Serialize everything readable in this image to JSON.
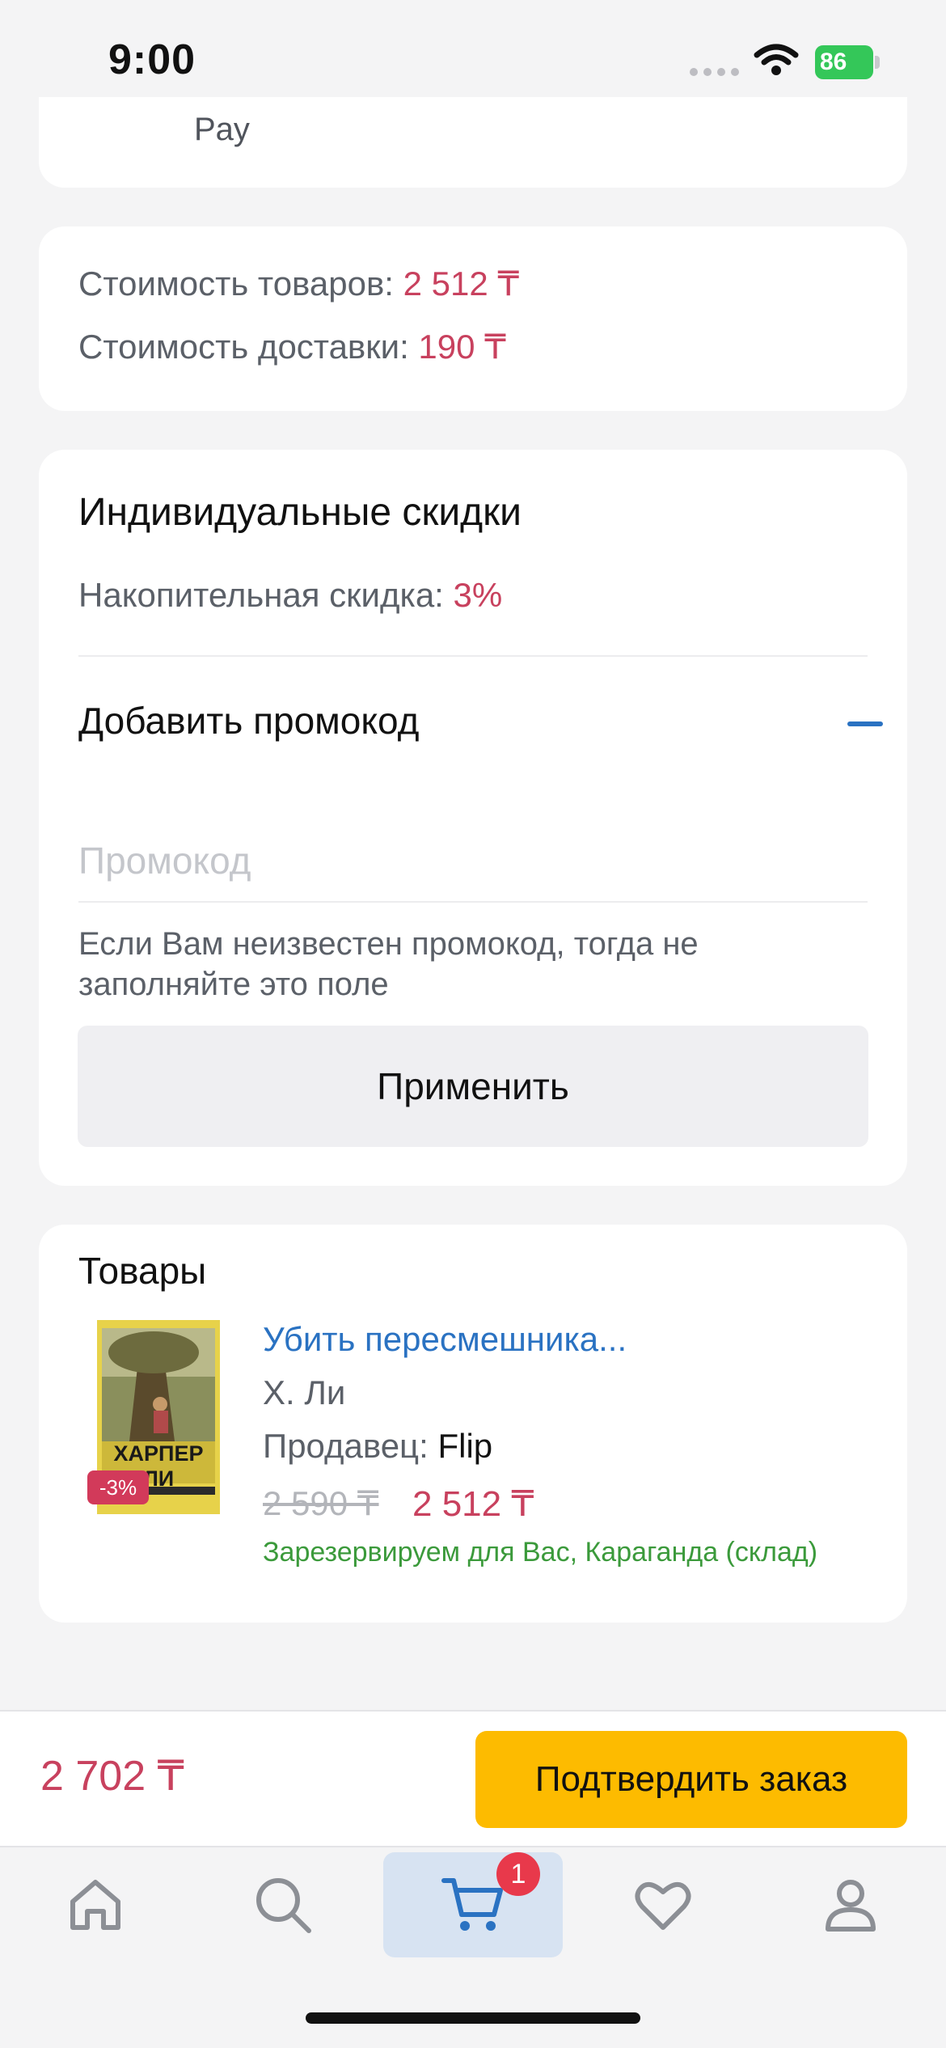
{
  "status_bar": {
    "time": "9:00",
    "battery": "86"
  },
  "payment": {
    "partial_text": "Pay"
  },
  "costs": {
    "goods_label": "Стоимость товаров:",
    "goods_value": "2 512 ₸",
    "delivery_label": "Стоимость доставки:",
    "delivery_value": "190 ₸"
  },
  "discounts": {
    "title": "Индивидуальные скидки",
    "cumulative_label": "Накопительная скидка:",
    "cumulative_value": "3%",
    "promo_header": "Добавить промокод",
    "promo_placeholder": "Промокод",
    "promo_value": "",
    "hint": "Если Вам неизвестен промокод, тогда не заполняйте это поле",
    "apply_label": "Применить"
  },
  "goods": {
    "title": "Товары",
    "items": [
      {
        "title": "Убить пересмешника...",
        "author": "Х. Ли",
        "seller_label": "Продавец:",
        "seller": "Flip",
        "old_price": "2 590 ₸",
        "new_price": "2 512 ₸",
        "discount_badge": "-3%",
        "cover_text": "ХАРПЕР ЛИ",
        "availability": "Зарезервируем для Вас, Караганда (склад)"
      }
    ]
  },
  "order": {
    "total": "2 702 ₸",
    "confirm_label": "Подтвердить заказ"
  },
  "tabs": [
    {
      "name": "home",
      "icon": "home-icon",
      "active": false
    },
    {
      "name": "search",
      "icon": "search-icon",
      "active": false
    },
    {
      "name": "cart",
      "icon": "cart-icon",
      "active": true,
      "badge": "1"
    },
    {
      "name": "favorites",
      "icon": "heart-icon",
      "active": false
    },
    {
      "name": "profile",
      "icon": "user-icon",
      "active": false
    }
  ],
  "colors": {
    "accent_red": "#c8415e",
    "link_blue": "#2a72c2",
    "confirm_yellow": "#fdbb00",
    "success_green": "#3b9a3b"
  }
}
